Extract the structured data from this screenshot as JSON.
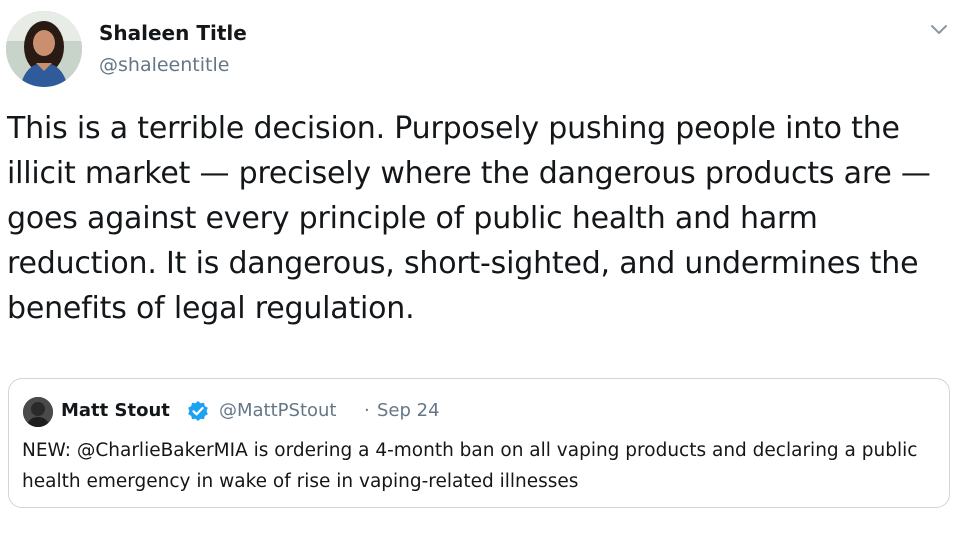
{
  "author": {
    "display_name": "Shaleen Title",
    "handle": "@shaleentitle"
  },
  "tweet": {
    "text": "This is a terrible decision. Purposely pushing people into the illicit market — precisely where the dangerous products are — goes against every principle of public health and harm reduction. It is dangerous, short-sighted, and undermines the benefits of legal regulation."
  },
  "icons": {
    "menu": "chevron-down-icon",
    "verified": "verified-badge-icon"
  },
  "quoted_tweet": {
    "display_name": "Matt Stout",
    "handle": "@MattPStout",
    "separator": "·",
    "date": "Sep 24",
    "text": "NEW: @CharlieBakerMIA is ordering a 4-month ban on all vaping products and declaring a public health emergency in wake of rise in vaping-related illnesses"
  },
  "colors": {
    "text_primary": "#14171a",
    "text_secondary": "#657786",
    "border": "#ccd6dd",
    "verified_blue": "#1da1f2"
  }
}
